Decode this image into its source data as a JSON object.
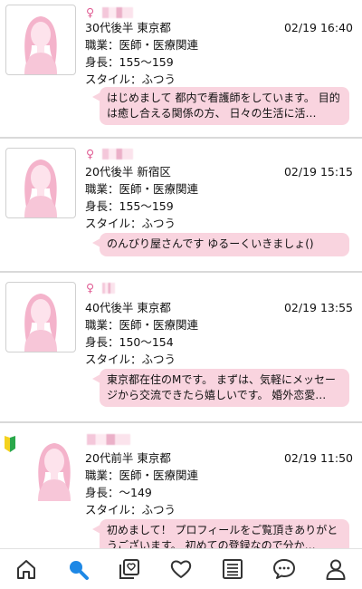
{
  "profiles": [
    {
      "gender_symbol": "♀",
      "age_area": "30代後半 東京都",
      "date": "02/19 16:40",
      "job": "職業：医師・医療関連",
      "height": "身長：155〜159",
      "style": "スタイル：ふつう",
      "message": "はじめまして 都内で看護師をしています。 目的は癒し合える関係の方、 日々の生活に活…",
      "beginner": false
    },
    {
      "gender_symbol": "♀",
      "age_area": "20代後半 新宿区",
      "date": "02/19 15:15",
      "job": "職業：医師・医療関連",
      "height": "身長：155〜159",
      "style": "スタイル：ふつう",
      "message": "のんびり屋さんです ゆるーくいきましょ()",
      "beginner": false
    },
    {
      "gender_symbol": "♀",
      "age_area": "40代後半 東京都",
      "date": "02/19 13:55",
      "job": "職業：医師・医療関連",
      "height": "身長：150〜154",
      "style": "スタイル：ふつう",
      "message": "東京都在住のMです。 まずは、気軽にメッセージから交流できたら嬉しいです。 婚外恋愛…",
      "beginner": false
    },
    {
      "gender_symbol": "",
      "age_area": "20代前半 東京都",
      "date": "02/19 11:50",
      "job": "職業：医師・医療関連",
      "height": "身長：〜149",
      "style": "スタイル：ふつう",
      "message": "初めまして！ プロフィールをご覧頂きありがとうございます。 初めての登録なので分か…",
      "beginner": true
    }
  ],
  "nav": {
    "items": [
      {
        "icon": "home-icon"
      },
      {
        "icon": "search-icon",
        "active": true
      },
      {
        "icon": "photo-gallery-icon"
      },
      {
        "icon": "heart-icon"
      },
      {
        "icon": "board-icon"
      },
      {
        "icon": "chat-icon"
      },
      {
        "icon": "profile-icon"
      }
    ]
  },
  "colors": {
    "bubble": "#f9d4df",
    "gender": "#e05c93",
    "active_nav": "#1e88e5",
    "avatar": "#f7c6d8"
  }
}
